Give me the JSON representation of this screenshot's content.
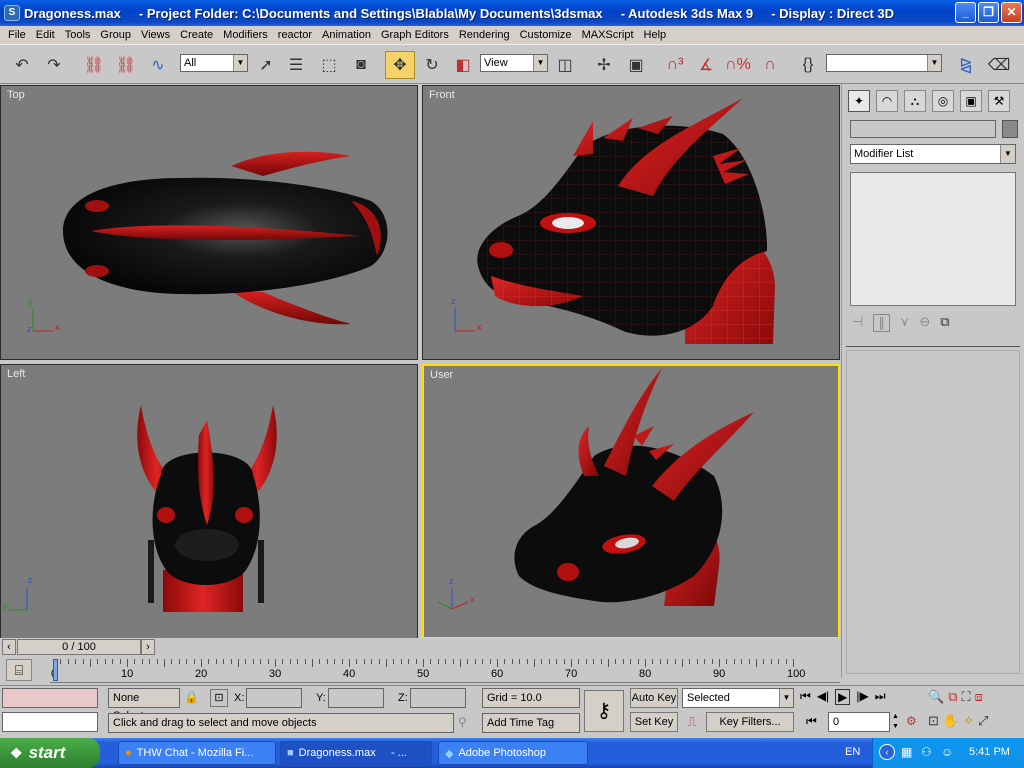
{
  "title": {
    "text": "Dragoness.max     - Project Folder: C:\\Documents and Settings\\Blabla\\My Documents\\3dsmax     - Autodesk 3ds Max 9     - Display : Direct 3D"
  },
  "menu": [
    "File",
    "Edit",
    "Tools",
    "Group",
    "Views",
    "Create",
    "Modifiers",
    "reactor",
    "Animation",
    "Graph Editors",
    "Rendering",
    "Customize",
    "MAXScript",
    "Help"
  ],
  "toolbar": {
    "selection_filter": "All",
    "ref_coord": "View"
  },
  "viewports": {
    "top": "Top",
    "front": "Front",
    "left": "Left",
    "user": "User"
  },
  "command_panel": {
    "modifier_list": "Modifier List"
  },
  "timeline": {
    "frame_counter": "0 / 100",
    "ticks": [
      "0",
      "10",
      "20",
      "30",
      "40",
      "50",
      "60",
      "70",
      "80",
      "90",
      "100"
    ]
  },
  "status": {
    "selection": "None Selecte",
    "x_label": "X:",
    "y_label": "Y:",
    "z_label": "Z:",
    "grid": "Grid = 10.0",
    "prompt": "Click and drag to select and move objects",
    "add_time_tag": "Add Time Tag",
    "auto_key": "Auto Key",
    "set_key": "Set Key",
    "key_mode": "Selected",
    "key_filters": "Key Filters...",
    "current_frame": "0"
  },
  "taskbar": {
    "start": "start",
    "tasks": [
      "THW Chat - Mozilla Fi...",
      "Dragoness.max     - ...",
      "Adobe Photoshop"
    ],
    "lang": "EN",
    "clock": "5:41 PM"
  },
  "colors": {
    "viewport_bg": "#7c7c7c",
    "active_border": "#ffe000",
    "model_red": "#c01010",
    "model_black": "#0c0c0c"
  }
}
